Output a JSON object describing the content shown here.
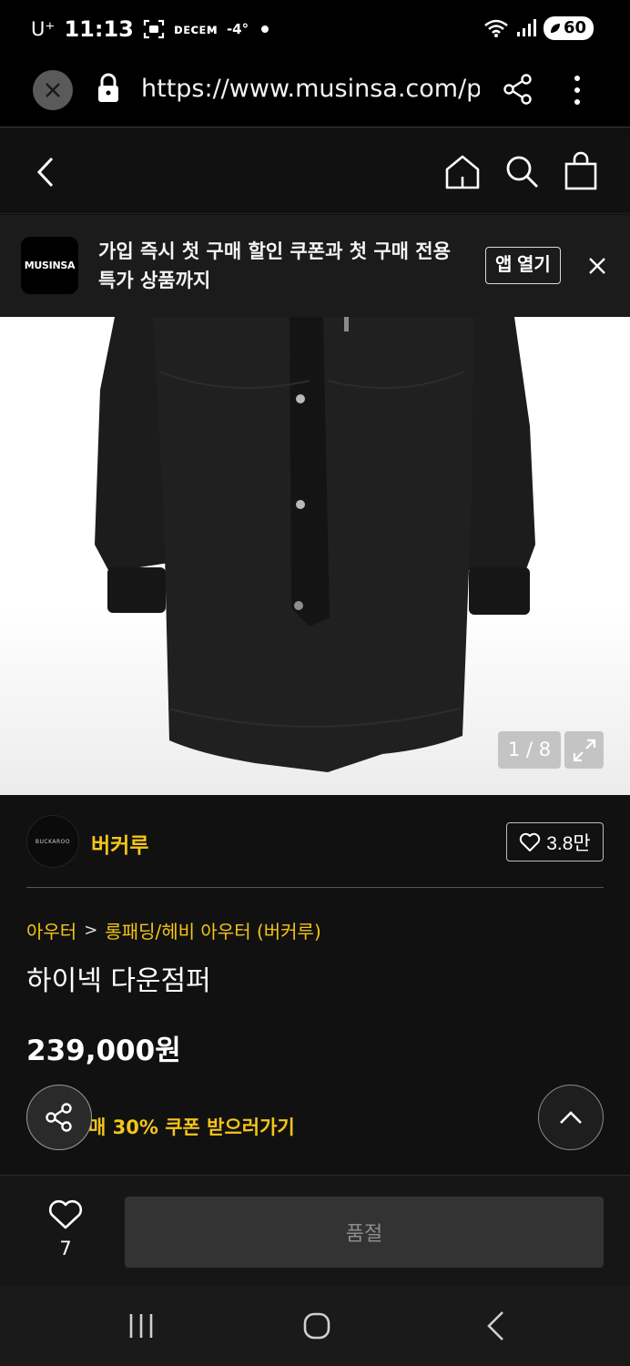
{
  "status_bar": {
    "carrier": "U⁺",
    "time": "11:13",
    "app_label": "ᴅᴇᴄᴇᴍ",
    "temperature": "-4°",
    "battery": "60"
  },
  "browser": {
    "url": "https://www.musinsa.com/pr"
  },
  "banner": {
    "logo_text": "MUSINSA",
    "message": "가입 즉시 첫 구매 할인 쿠폰과 첫 구매 전용 특가 상품까지",
    "open_app_label": "앱 열기"
  },
  "gallery": {
    "counter": "1 / 8"
  },
  "brand": {
    "logo_text": "BUCKAROO",
    "name": "버커루",
    "likes": "3.8만"
  },
  "breadcrumb": {
    "category": "아우터",
    "separator": ">",
    "subcategory": "롱패딩/헤비 아우터 (버커루)"
  },
  "product": {
    "title": "하이넥 다운점퍼",
    "price": "239,000원",
    "coupon_text": "매 30% 쿠폰 받으러가기"
  },
  "purchase_bar": {
    "wish_count": "7",
    "buy_label": "품절"
  },
  "colors": {
    "accent": "#f5c518",
    "background": "#111111",
    "disabled_button": "#333333"
  },
  "icons": [
    "close-icon",
    "lock-icon",
    "share-icon",
    "more-vert-icon",
    "back-arrow-icon",
    "home-icon",
    "search-icon",
    "shopping-bag-icon",
    "expand-icon",
    "heart-icon",
    "chevron-up-icon",
    "recents-icon",
    "nav-home-icon",
    "nav-back-icon"
  ]
}
